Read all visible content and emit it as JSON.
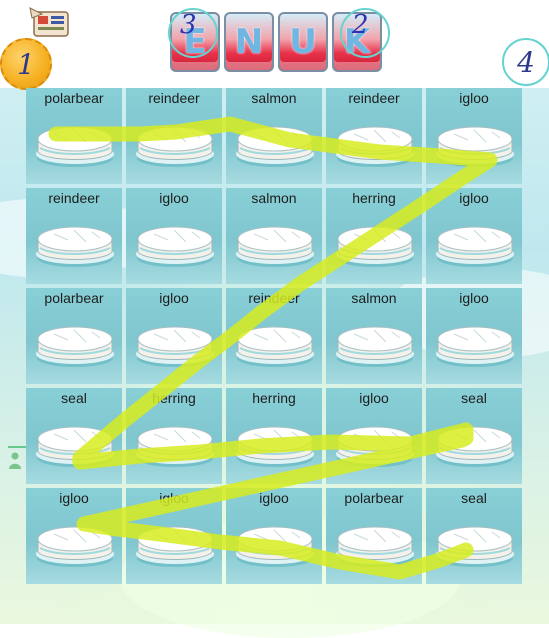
{
  "header": {
    "title_letters": [
      "E",
      "N",
      "U",
      "K"
    ],
    "title_annotation_left": "3",
    "title_annotation_right": "2",
    "left_badge": "1",
    "right_badge": "4"
  },
  "board": {
    "rows": [
      [
        "polarbear",
        "reindeer",
        "salmon",
        "reindeer",
        "igloo"
      ],
      [
        "reindeer",
        "igloo",
        "salmon",
        "herring",
        "igloo"
      ],
      [
        "polarbear",
        "igloo",
        "reindeer",
        "salmon",
        "igloo"
      ],
      [
        "seal",
        "herring",
        "herring",
        "igloo",
        "seal"
      ],
      [
        "igloo",
        "igloo",
        "igloo",
        "polarbear",
        "seal"
      ]
    ]
  },
  "colors": {
    "path": "#d7ec1e",
    "tile": "#86cdd5",
    "accent": "#67d3cf",
    "badge": "#f5b021"
  }
}
